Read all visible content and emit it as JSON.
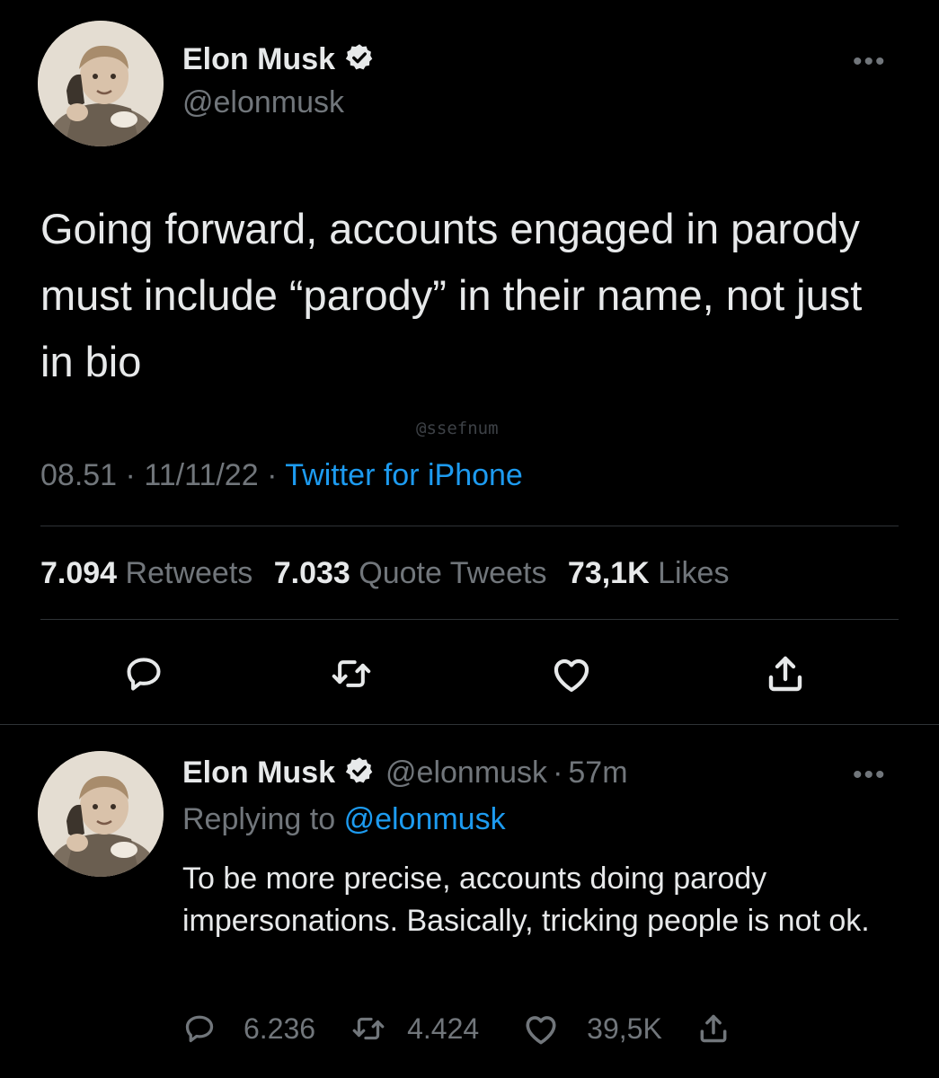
{
  "main_tweet": {
    "author_name": "Elon Musk",
    "author_handle": "@elonmusk",
    "more_label": "•••",
    "text": "Going forward, accounts engaged in parody must include “parody” in their name, not just in bio",
    "watermark": "@ssefnum",
    "time": "08.51",
    "date": "11/11/22",
    "separator": "·",
    "source": "Twitter for iPhone",
    "stats": {
      "retweets_count": "7.094",
      "retweets_label": "Retweets",
      "quotes_count": "7.033",
      "quotes_label": "Quote Tweets",
      "likes_count": "73,1K",
      "likes_label": "Likes"
    },
    "actions": [
      "reply-icon",
      "retweet-icon",
      "like-icon",
      "share-icon"
    ]
  },
  "reply_tweet": {
    "author_name": "Elon Musk",
    "author_handle": "@elonmusk",
    "separator": "·",
    "age": "57m",
    "more_label": "•••",
    "replying_prefix": "Replying to",
    "replying_handle": "@elonmusk",
    "text": "To be more precise, accounts doing parody impersonations. Basically, tricking people is not ok.",
    "reply_count": "6.236",
    "retweet_count": "4.424",
    "like_count": "39,5K"
  },
  "colors": {
    "background": "#000000",
    "text": "#e7e9ea",
    "muted": "#71767b",
    "accent": "#1d9bf0",
    "divider": "#2f3336"
  }
}
